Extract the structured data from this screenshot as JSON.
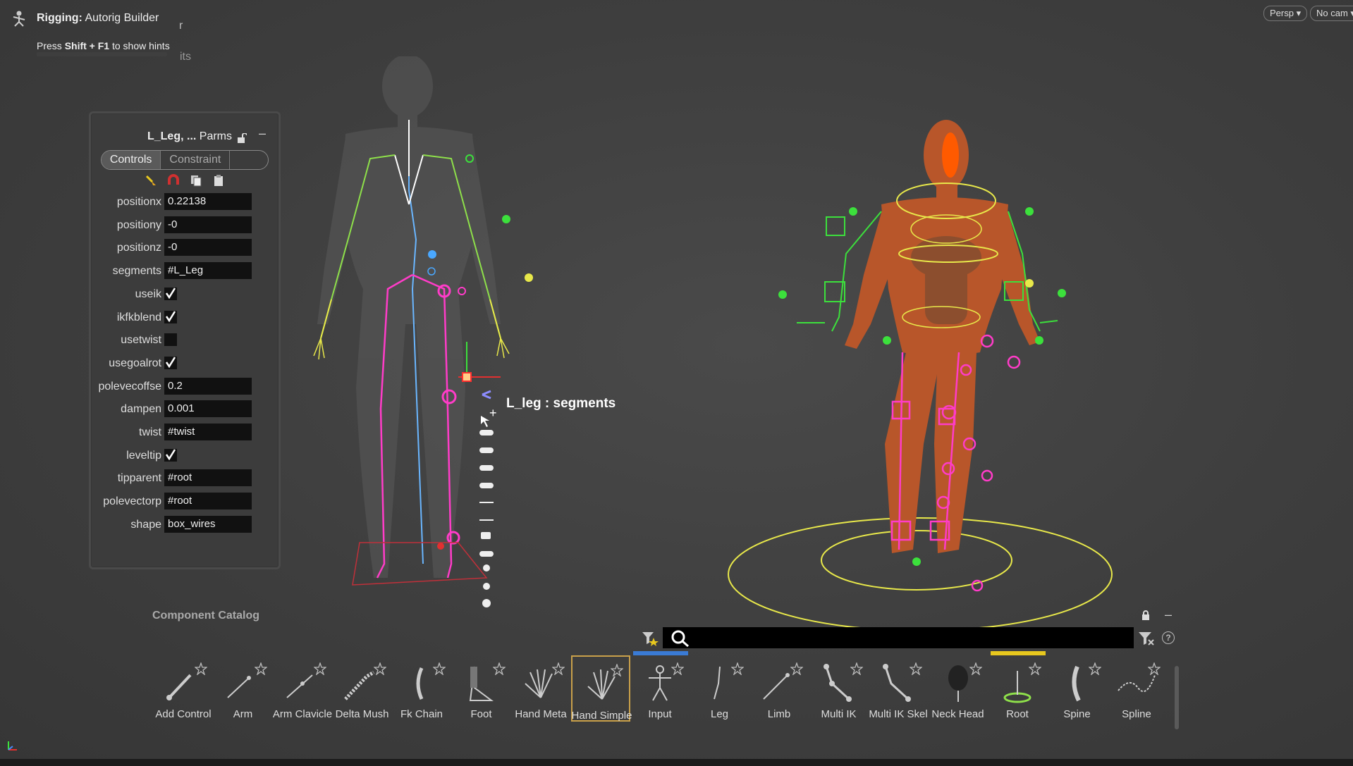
{
  "header": {
    "title_bold": "Rigging:",
    "title_rest": " Autorig Builder",
    "hint_pre": "Press ",
    "hint_key": "Shift + F1",
    "hint_post": " to show hints",
    "ghost_r": "r",
    "ghost_ts": "its"
  },
  "camera": {
    "persp_label": "Persp ▾",
    "nocam_label": "No cam ▾"
  },
  "parms": {
    "title_bold": "L_Leg, ...",
    "title_rest": " Parms",
    "minimize": "–",
    "tabs": [
      "Controls",
      "Constraint",
      ""
    ],
    "rows": [
      {
        "label": "positionx",
        "type": "field",
        "value": "0.22138"
      },
      {
        "label": "positiony",
        "type": "field",
        "value": "-0"
      },
      {
        "label": "positionz",
        "type": "field",
        "value": "-0"
      },
      {
        "label": "segments",
        "type": "field",
        "value": "#L_Leg"
      },
      {
        "label": "useik",
        "type": "check",
        "checked": true
      },
      {
        "label": "ikfkblend",
        "type": "check",
        "checked": true
      },
      {
        "label": "usetwist",
        "type": "check",
        "checked": false
      },
      {
        "label": "usegoalrot",
        "type": "check",
        "checked": true
      },
      {
        "label": "polevecoffse",
        "type": "field",
        "value": "0.2"
      },
      {
        "label": "dampen",
        "type": "field",
        "value": "0.001"
      },
      {
        "label": "twist",
        "type": "field",
        "value": "#twist"
      },
      {
        "label": "leveltip",
        "type": "check",
        "checked": true
      },
      {
        "label": "tipparent",
        "type": "field",
        "value": "#root"
      },
      {
        "label": "polevectorp",
        "type": "field",
        "value": "#root"
      },
      {
        "label": "shape",
        "type": "field",
        "value": "box_wires"
      }
    ]
  },
  "viewport": {
    "hover_label": "L_leg : segments"
  },
  "catalog": {
    "title": "Component Catalog",
    "help": "?",
    "minimize": "–",
    "items": [
      {
        "label": "Add Control",
        "icon": "add-control-icon"
      },
      {
        "label": "Arm",
        "icon": "arm-icon"
      },
      {
        "label": "Arm Clavicle",
        "icon": "arm-clavicle-icon"
      },
      {
        "label": "Delta Mush",
        "icon": "delta-mush-icon"
      },
      {
        "label": "Fk Chain",
        "icon": "fk-chain-icon"
      },
      {
        "label": "Foot",
        "icon": "foot-icon"
      },
      {
        "label": "Hand Meta",
        "icon": "hand-meta-icon"
      },
      {
        "label": "Hand Simple",
        "icon": "hand-simple-icon",
        "selected": true
      },
      {
        "label": "Input",
        "icon": "input-icon",
        "bar": "#3a7bd5"
      },
      {
        "label": "Leg",
        "icon": "leg-icon"
      },
      {
        "label": "Limb",
        "icon": "limb-icon"
      },
      {
        "label": "Multi IK",
        "icon": "multi-ik-icon"
      },
      {
        "label": "Multi IK Skel",
        "icon": "multi-ik-skel-icon"
      },
      {
        "label": "Neck Head",
        "icon": "neck-head-icon"
      },
      {
        "label": "Root",
        "icon": "root-icon",
        "bar": "#e8c81e"
      },
      {
        "label": "Spine",
        "icon": "spine-icon"
      },
      {
        "label": "Spline",
        "icon": "spline-icon"
      }
    ]
  },
  "colors": {
    "accent_selected": "#c9a04a",
    "input_bar": "#3a7bd5",
    "root_bar": "#e8c81e",
    "rig_magenta": "#ff3cc8",
    "rig_green": "#3ce03c",
    "rig_yellow": "#e8e84a"
  }
}
